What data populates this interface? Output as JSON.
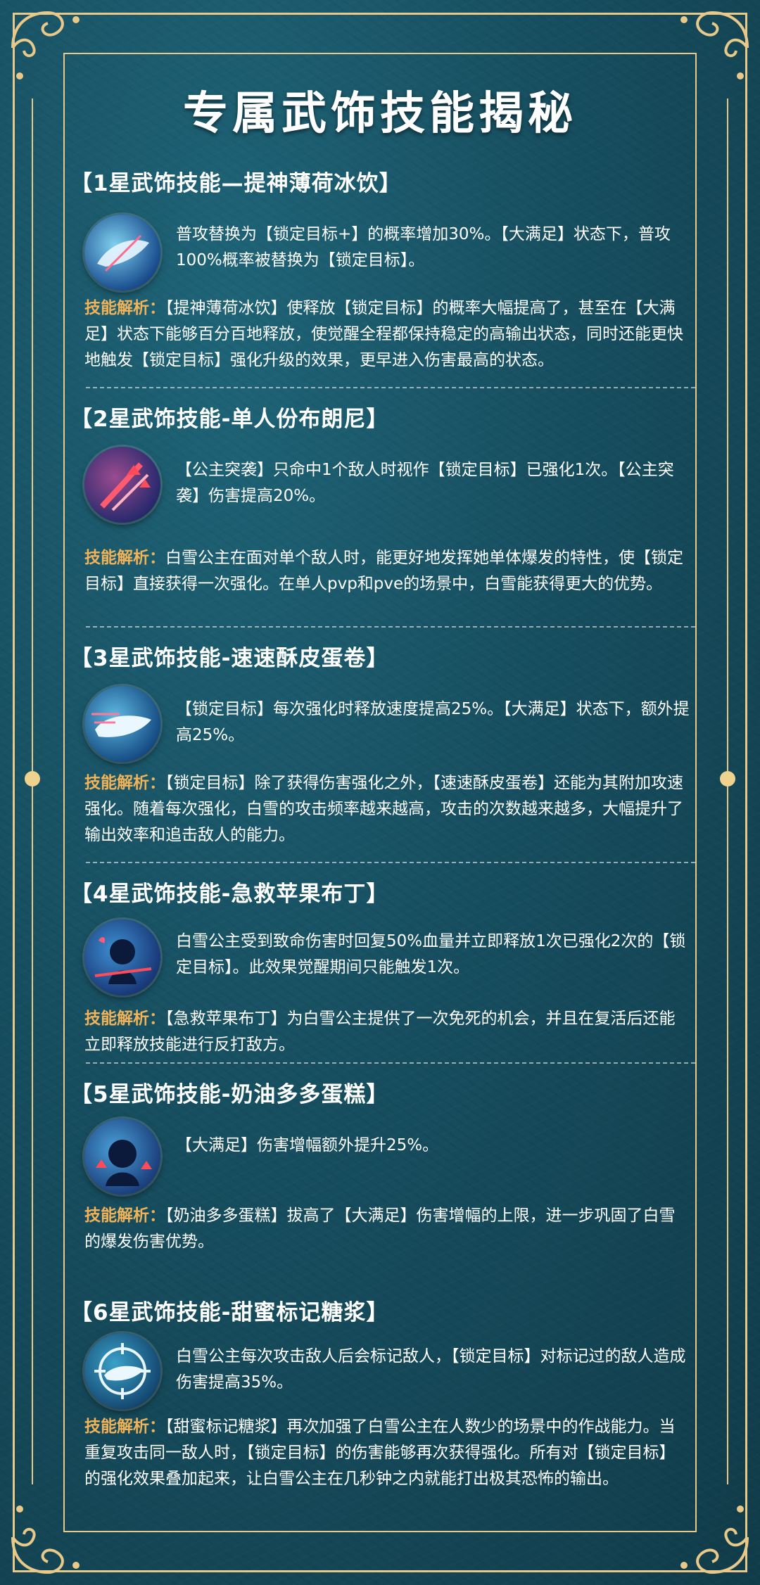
{
  "title": "专属武饰技能揭秘",
  "analysis_label": "技能解析：",
  "colors": {
    "accent_gold": "#e8c98a",
    "label_orange": "#f0b35a",
    "bg": "#174f60"
  },
  "skills": [
    {
      "title": "【1星武饰技能—提神薄荷冰饮】",
      "icon": "whale-splash-icon",
      "description": "普攻替换为【锁定目标+】的概率增加30%。【大满足】状态下，普攻100%概率被替换为【锁定目标】。",
      "analysis": "【提神薄荷冰饮】使释放【锁定目标】的概率大幅提高了，甚至在【大满足】状态下能够百分百地释放，使觉醒全程都保持稳定的高输出状态，同时还能更快地触发【锁定目标】强化升级的效果，更早进入伤害最高的状态。"
    },
    {
      "title": "【2星武饰技能-单人份布朗尼】",
      "icon": "slash-up-arrows-icon",
      "description": "【公主突袭】只命中1个敌人时视作【锁定目标】已强化1次。【公主突袭】伤害提高20%。",
      "analysis": "白雪公主在面对单个敌人时，能更好地发挥她单体爆发的特性，使【锁定目标】直接获得一次强化。在单人pvp和pve的场景中，白雪能获得更大的优势。"
    },
    {
      "title": "【3星武饰技能-速速酥皮蛋卷】",
      "icon": "whale-speed-icon",
      "description": "【锁定目标】每次强化时释放速度提高25%。【大满足】状态下，额外提高25%。",
      "analysis": "【锁定目标】除了获得伤害强化之外，【速速酥皮蛋卷】还能为其附加攻速强化。随着每次强化，白雪的攻击频率越来越高，攻击的次数越来越多，大幅提升了输出效率和追击敌人的能力。"
    },
    {
      "title": "【4星武饰技能-急救苹果布丁】",
      "icon": "revive-character-icon",
      "description": "白雪公主受到致命伤害时回复50%血量并立即释放1次已强化2次的【锁定目标】。此效果觉醒期间只能触发1次。",
      "analysis": "【急救苹果布丁】为白雪公主提供了一次免死的机会，并且在复活后还能立即释放技能进行反打敌方。"
    },
    {
      "title": "【5星武饰技能-奶油多多蛋糕】",
      "icon": "damage-boost-character-icon",
      "description": "【大满足】伤害增幅额外提升25%。",
      "analysis": "【奶油多多蛋糕】拔高了【大满足】伤害增幅的上限，进一步巩固了白雪的爆发伤害优势。"
    },
    {
      "title": "【6星武饰技能-甜蜜标记糖浆】",
      "icon": "target-mark-icon",
      "description": "白雪公主每次攻击敌人后会标记敌人，【锁定目标】对标记过的敌人造成伤害提高35%。",
      "analysis": "【甜蜜标记糖浆】再次加强了白雪公主在人数少的场景中的作战能力。当重复攻击同一敌人时，【锁定目标】的伤害能够再次获得强化。所有对【锁定目标】的强化效果叠加起来，让白雪公主在几秒钟之内就能打出极其恐怖的输出。"
    }
  ]
}
